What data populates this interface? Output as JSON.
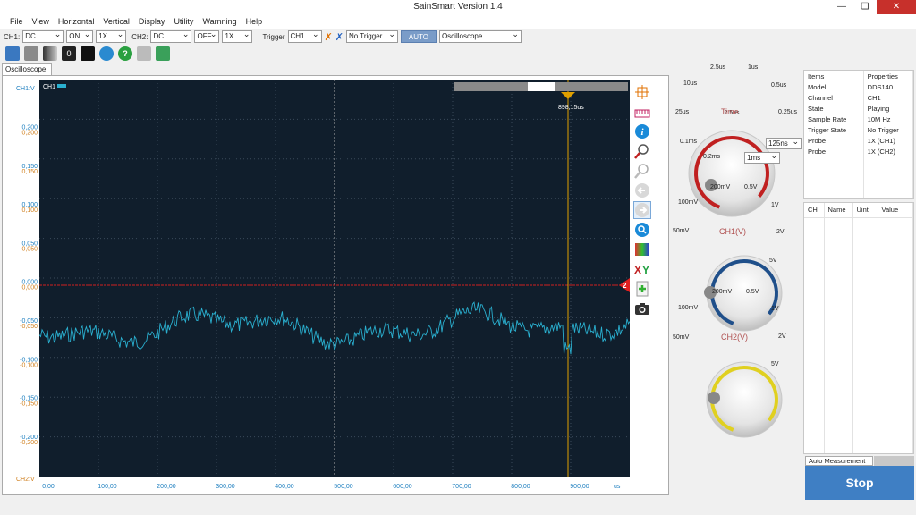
{
  "window": {
    "title": "SainSmart  Version 1.4"
  },
  "menu": [
    "File",
    "View",
    "Horizontal",
    "Vertical",
    "Display",
    "Utility",
    "Warnning",
    "Help"
  ],
  "controls": {
    "ch1_label": "CH1:",
    "ch1_coupling": "DC",
    "ch1_state": "ON",
    "ch1_probe": "1X",
    "ch2_label": "CH2:",
    "ch2_coupling": "DC",
    "ch2_state": "OFF",
    "ch2_probe": "1X",
    "trigger_label": "Trigger",
    "trigger_source": "CH1",
    "trigger_mode": "No Trigger",
    "auto_label": "AUTO",
    "view_mode": "Oscilloscope"
  },
  "toolbar": {
    "counter": "0"
  },
  "tab": {
    "label": "Oscilloscope"
  },
  "scope": {
    "ch1_unit": "CH1:V",
    "ch2_unit": "CH2:V",
    "ch1_tag": "CH1",
    "cursor_readout": "898,15us",
    "x_unit": "us",
    "x_ticks": [
      "0,00",
      "100,00",
      "200,00",
      "300,00",
      "400,00",
      "500,00",
      "600,00",
      "700,00",
      "800,00",
      "900,00"
    ],
    "y_ticks_ch1": [
      "0,200",
      "0,150",
      "0,100",
      "0,050",
      "0,000",
      "-0,050",
      "-0,100",
      "-0,150",
      "-0,200"
    ],
    "y_ticks_ch2": [
      "0,200",
      "0,150",
      "0,100",
      "0,050",
      "0,000",
      "-0,050",
      "-0,100",
      "-0,150",
      "-0,200"
    ],
    "ch2_marker": "2",
    "colors": {
      "background": "#101e2c",
      "grid": "#3a4a5a",
      "trace": "#2ab0d0",
      "zero_line": "#d02020",
      "cursor": "#e0a000"
    }
  },
  "time_knob": {
    "label": "Time",
    "scale": [
      "2.5us",
      "1us",
      "0.5us",
      "0.25us",
      "0.1ms",
      "0.2ms",
      "25us",
      "10us"
    ],
    "value_small": "125ns",
    "value": "1ms",
    "ring_color": "#c02020"
  },
  "ch1_knob": {
    "label": "CH1(V)",
    "scale": [
      "200mV",
      "0.5V",
      "1V",
      "2V",
      "5V",
      "100mV",
      "50mV"
    ],
    "ring_color": "#1f4f8a"
  },
  "ch2_knob": {
    "label": "CH2(V)",
    "scale": [
      "200mV",
      "0.5V",
      "1V",
      "2V",
      "5V",
      "100mV",
      "50mV"
    ],
    "ring_color": "#e0d020"
  },
  "properties": {
    "headers": [
      "Items",
      "Properties"
    ],
    "rows": [
      [
        "Model",
        "DDS140"
      ],
      [
        "Channel",
        "CH1"
      ],
      [
        "State",
        "Playing"
      ],
      [
        "Sample Rate",
        "10M Hz"
      ],
      [
        "Trigger State",
        "No Trigger"
      ],
      [
        "Probe",
        "1X (CH1)"
      ],
      [
        "Probe",
        "1X (CH2)"
      ]
    ]
  },
  "measurement": {
    "headers": [
      "CH",
      "Name",
      "Uint",
      "Value"
    ],
    "tab_label": "Auto Measurement"
  },
  "stop_button": {
    "label": "Stop"
  }
}
